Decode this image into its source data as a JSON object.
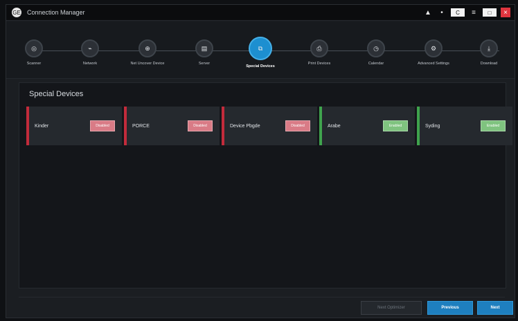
{
  "window": {
    "title": "Connection Manager",
    "logo_text": "GE"
  },
  "titlebar": {
    "bell_icon": "bell-icon",
    "dots_icon": "dots-icon",
    "box1_label": "C",
    "list_icon": "list-icon",
    "box2_label": "□",
    "close_label": "×"
  },
  "stepper": {
    "steps": [
      {
        "label": "Scanner",
        "icon": "scanner-icon",
        "glyph": "◎"
      },
      {
        "label": "Network",
        "icon": "network-icon",
        "glyph": "⌁"
      },
      {
        "label": "Net Uncover Device",
        "icon": "device-icon",
        "glyph": "⊕"
      },
      {
        "label": "Server",
        "icon": "server-icon",
        "glyph": "▤"
      },
      {
        "label": "Special Devices",
        "icon": "special-devices-icon",
        "glyph": "⧉"
      },
      {
        "label": "Print Devices",
        "icon": "printer-icon",
        "glyph": "⎙"
      },
      {
        "label": "Calendar",
        "icon": "calendar-icon",
        "glyph": "◷"
      },
      {
        "label": "Advanced Settings",
        "icon": "settings-icon",
        "glyph": "⚙"
      },
      {
        "label": "Download",
        "icon": "download-icon",
        "glyph": "⤓"
      }
    ],
    "active_index": 4
  },
  "content": {
    "section_title": "Special Devices",
    "devices": [
      {
        "name": "Kinder",
        "badge": "Disabled",
        "status_color": "#c32b3b",
        "badge_color": "#d97b86"
      },
      {
        "name": "PORCE",
        "badge": "Disabled",
        "status_color": "#c32b3b",
        "badge_color": "#d97b86"
      },
      {
        "name": "Device Pbgde",
        "badge": "Disabled",
        "status_color": "#c32b3b",
        "badge_color": "#d97b86"
      },
      {
        "name": "Arabe",
        "badge": "Enabled",
        "status_color": "#3fa34d",
        "badge_color": "#7fc37f"
      },
      {
        "name": "Syding",
        "badge": "Enabled",
        "status_color": "#3fa34d",
        "badge_color": "#7fc37f"
      }
    ]
  },
  "footer": {
    "secondary_label": "Next Optimizer",
    "previous_label": "Previous",
    "next_label": "Next"
  }
}
